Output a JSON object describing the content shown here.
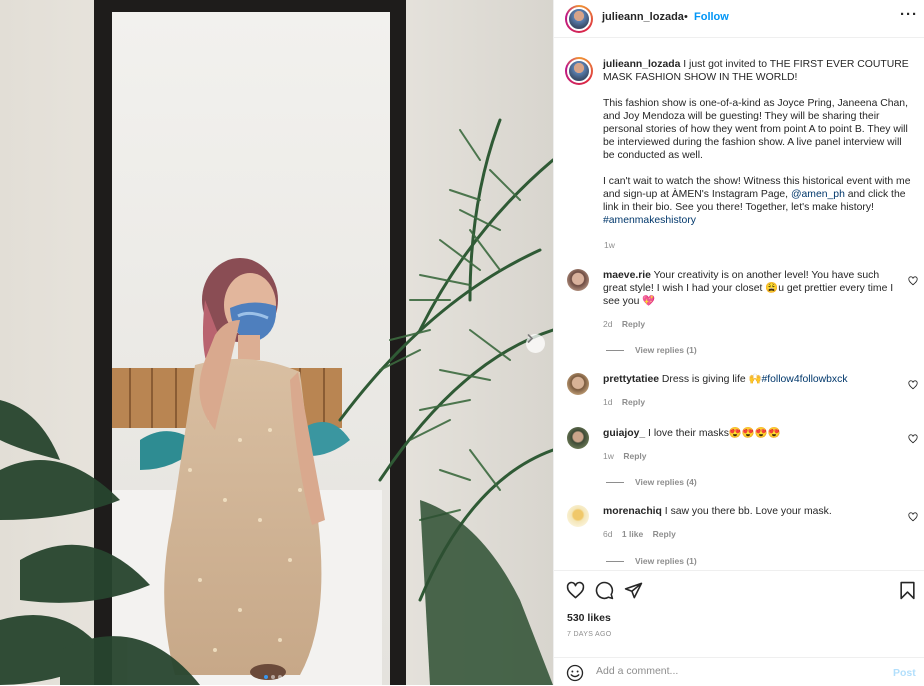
{
  "header": {
    "username": "julieann_lozada",
    "separator": "•",
    "follow_label": "Follow",
    "more_label": "···"
  },
  "caption": {
    "username": "julieann_lozada",
    "line1": "I just got invited to THE FIRST EVER COUTURE MASK FASHION SHOW IN THE WORLD!",
    "para2": "This fashion show is one-of-a-kind as Joyce Pring, Janeena Chan, and Joy Mendoza will be guesting! They will be sharing their personal stories of how they went from point A to point B. They will be interviewed during the fashion show. A live panel interview will be conducted as well.",
    "para3_start": "I can't wait to watch the show! Witness this historical event with me and sign-up at ÀMEN's Instagram Page, ",
    "mention": "@amen_ph",
    "para3_end": " and click the link in their bio. See you there! Together, let's make history!",
    "hashtag": "#amenmakeshistory",
    "time": "1w"
  },
  "comments": [
    {
      "username": "maeve.rie",
      "text": "Your creativity is on another level! You have such great style! I wish I had your closet 😩u get prettier every time I see you 💖",
      "time": "2d",
      "reply_label": "Reply",
      "view_replies": "View replies (1)"
    },
    {
      "username": "prettytatiee",
      "text": "Dress is giving life 🙌",
      "hashtag": "#follow4followbxck",
      "time": "1d",
      "reply_label": "Reply"
    },
    {
      "username": "guiajoy_",
      "text": "I love their masks😍😍😍😍",
      "time": "1w",
      "reply_label": "Reply",
      "view_replies": "View replies (4)"
    },
    {
      "username": "morenachiq",
      "text": "I saw you there bb. Love your mask.",
      "time": "6d",
      "likes": "1 like",
      "reply_label": "Reply",
      "view_replies": "View replies (1)"
    }
  ],
  "footer": {
    "likes": "530 likes",
    "date": "7 DAYS AGO",
    "comment_placeholder": "Add a comment...",
    "post_label": "Post"
  },
  "carousel": {
    "slide_count": 3,
    "active_slide": 1
  },
  "colors": {
    "link": "#00376b",
    "follow": "#0095f6",
    "post_disabled": "#b2dffc",
    "carousel_active": "#3897f0"
  },
  "icons": [
    "chevron-right-icon",
    "heart-icon",
    "comment-icon",
    "share-icon",
    "bookmark-icon",
    "smiley-icon",
    "more-icon"
  ]
}
